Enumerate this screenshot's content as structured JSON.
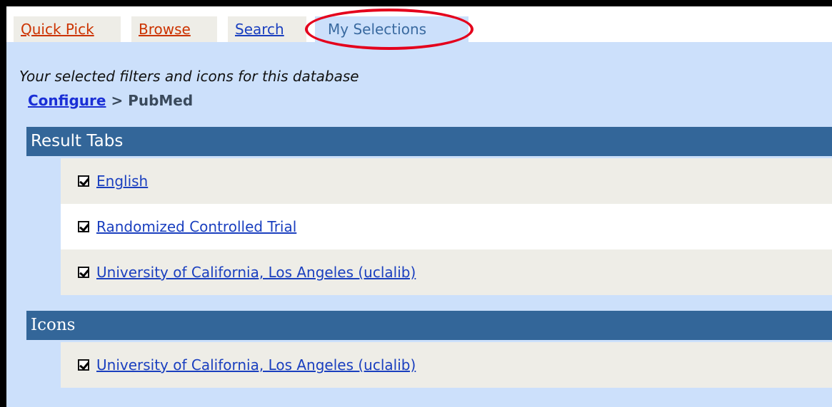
{
  "tabs": {
    "quick_pick": "Quick Pick",
    "browse": "Browse",
    "search": "Search",
    "my_selections": "My Selections"
  },
  "subtitle": "Your selected filters and icons for this database",
  "breadcrumb": {
    "link": "Configure",
    "separator": ">",
    "current": "PubMed"
  },
  "sections": {
    "result_tabs": {
      "title": "Result Tabs",
      "items": [
        "English",
        "Randomized Controlled Trial",
        "University of California, Los Angeles (uclalib)"
      ]
    },
    "icons": {
      "title": "Icons",
      "items": [
        "University of California, Los Angeles (uclalib)"
      ]
    }
  },
  "colors": {
    "panel_background": "#cce0fb",
    "section_header": "#336699",
    "highlight_oval": "#e4001c",
    "inactive_tab_link": "#cc3300",
    "link": "#1a3fbf"
  }
}
